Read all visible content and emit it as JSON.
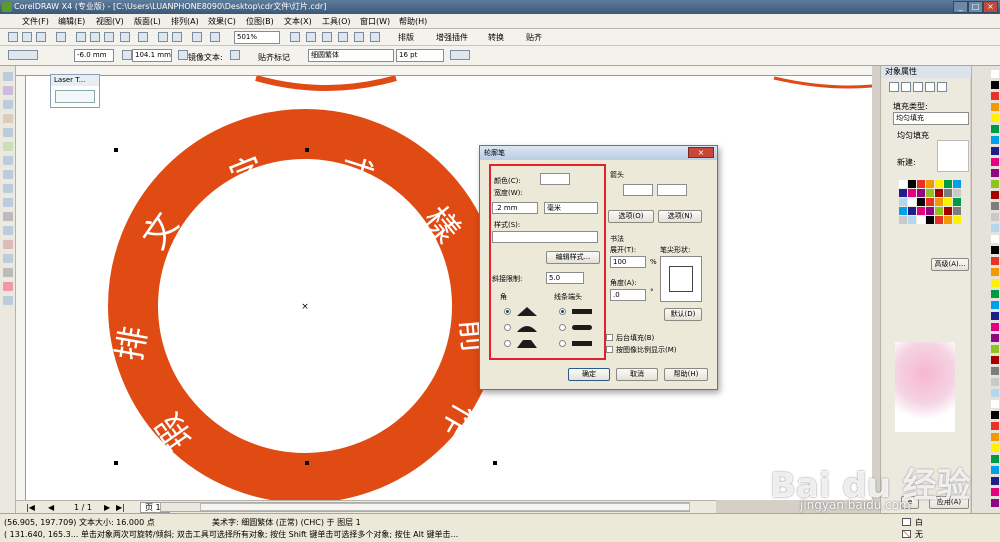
{
  "window": {
    "title": "CorelDRAW X4 (专业版) - [C:\\Users\\LUANPHONE8090\\Desktop\\cdr文件\\灯片.cdr]",
    "controls": [
      "_",
      "□",
      "×"
    ]
  },
  "menu": [
    "文件(F)",
    "编辑(E)",
    "视图(V)",
    "版面(L)",
    "排列(A)",
    "效果(C)",
    "位图(B)",
    "文本(X)",
    "工具(O)",
    "窗口(W)",
    "帮助(H)"
  ],
  "toolbar": {
    "zoom": "501%",
    "buttons": [
      "排版",
      "增强插件",
      "转换",
      "贴齐"
    ]
  },
  "propertybar": {
    "x_value": "-6.0 mm",
    "width_value": "104.1 mm",
    "mirror_label": "镜像文本:",
    "snap_label": "贴齐标记",
    "font_name": "细圆繁体",
    "font_size": "16 pt"
  },
  "laser_toolbar": {
    "title": "Laser T..."
  },
  "canvas": {
    "ring_color": "#e04a13",
    "ring_text": [
      "排",
      "文",
      "字",
      "式",
      "樣",
      "前",
      "作",
      "瑕"
    ]
  },
  "dialog": {
    "title": "轮廓笔",
    "color_label": "颜色(C):",
    "width_label": "宽度(W):",
    "width_value": ".2 mm",
    "unit_value": "毫米",
    "style_label": "样式(S):",
    "edit_style_button": "编辑样式...",
    "miter_label": "斜接限制:",
    "miter_value": "5.0",
    "corners_label": "角",
    "line_caps_label": "线条端头",
    "arrows_label": "箭头",
    "options_left": "选项(O)",
    "options_right": "选项(N)",
    "calligraphy_label": "书法",
    "stretch_label": "展开(T):",
    "stretch_value": "100",
    "stretch_unit": "%",
    "angle_label": "角度(A):",
    "angle_value": ".0",
    "angle_unit": "°",
    "nib_shape_label": "笔尖形状:",
    "default_button": "默认(D)",
    "behind_fill_label": "后台填充(B)",
    "scale_with_image_label": "按图像比例显示(M)",
    "ok_button": "确定",
    "cancel_button": "取消",
    "help_button": "帮助(H)"
  },
  "object_properties": {
    "title": "对象属性",
    "fill_type_label": "填充类型:",
    "fill_type_value": "均匀填充",
    "uniform_fill_label": "均匀填充",
    "new_label": "新建:",
    "advanced_button": "高级(A)...",
    "apply_button": "应用(A)"
  },
  "pagebar": {
    "page_count": "1 / 1",
    "page_tab": "页 1"
  },
  "status": {
    "line1_left": "(56.905, 197.709)  文本大小: 16.000 点",
    "line1_mid": "美术字: 细圆繁体 (正常) (CHC) 于 图层 1",
    "line2": "( 131.640, 165.3...  单击对象两次可旋转/倾斜; 双击工具可选择所有对象; 按住 Shift 键单击可选择多个对象; 按住 Alt 键单击...",
    "fill_label": "白",
    "outline_label": "无"
  },
  "watermark": {
    "brand": "Bai du 经验",
    "url": "jingyan.baidu.com"
  },
  "palette_colors": [
    "#ffffff",
    "#000000",
    "#e63227",
    "#f39800",
    "#fff100",
    "#009944",
    "#00a0e9",
    "#1d2088",
    "#e4007f",
    "#920783",
    "#8fc31f",
    "#a40000",
    "#7d7d7d",
    "#c9c9c9",
    "#b4d7ee"
  ]
}
